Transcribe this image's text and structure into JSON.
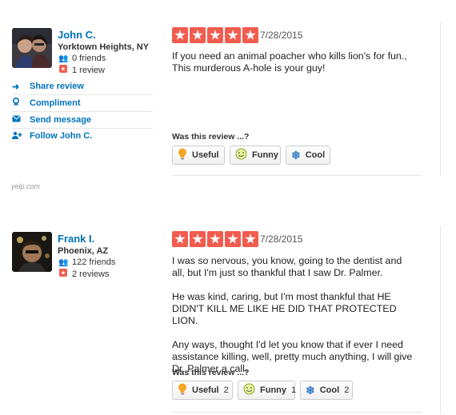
{
  "watermark": "yelp.com",
  "prompt_label": "Was this review ...?",
  "reviews": [
    {
      "user": {
        "name": "John C.",
        "location": "Yorktown Heights, NY",
        "friends": "0 friends",
        "reviews": "1 review"
      },
      "actions": [
        {
          "label": "Share review",
          "icon": "share-icon"
        },
        {
          "label": "Compliment",
          "icon": "compliment-icon"
        },
        {
          "label": "Send message",
          "icon": "message-icon"
        },
        {
          "label": "Follow John C.",
          "icon": "follow-icon"
        }
      ],
      "rating": 5,
      "date": "7/28/2015",
      "paragraphs": [
        "If you need an animal poacher who kills lion's for fun., This murderous A-hole is your guy!"
      ],
      "votes": {
        "useful": {
          "label": "Useful",
          "count": ""
        },
        "funny": {
          "label": "Funny",
          "count": ""
        },
        "cool": {
          "label": "Cool",
          "count": ""
        }
      }
    },
    {
      "user": {
        "name": "Frank I.",
        "location": "Phoenix, AZ",
        "friends": "122 friends",
        "reviews": "2 reviews"
      },
      "rating": 5,
      "date": "7/28/2015",
      "paragraphs": [
        "I was so nervous, you know, going to the dentist and all, but I'm just so thankful that I saw Dr. Palmer.",
        "He was kind, caring, but I'm most thankful that HE DIDN'T KILL ME LIKE HE DID THAT PROTECTED LION.",
        "Any ways, thought I'd let you know that if ever I need assistance killing, well, pretty much anything, I will give Dr. Palmer a call."
      ],
      "votes": {
        "useful": {
          "label": "Useful",
          "count": "2"
        },
        "funny": {
          "label": "Funny",
          "count": "1"
        },
        "cool": {
          "label": "Cool",
          "count": "2"
        }
      }
    }
  ],
  "colors": {
    "star_red": "#f15c4f",
    "link_blue": "#0073bb"
  }
}
